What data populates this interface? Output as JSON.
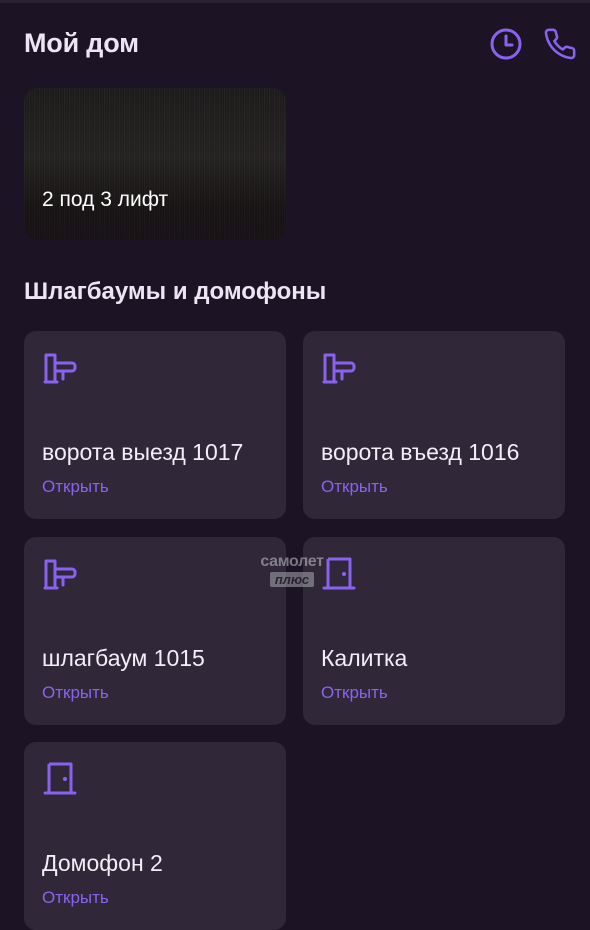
{
  "header": {
    "title": "Мой дом",
    "history_icon": "clock-icon",
    "call_icon": "phone-icon"
  },
  "camera": {
    "label": "2 под 3 лифт"
  },
  "section": {
    "title": "Шлагбаумы и домофоны"
  },
  "devices": [
    {
      "name": "ворота выезд 1017",
      "action": "Открыть",
      "icon": "barrier-icon"
    },
    {
      "name": "ворота въезд 1016",
      "action": "Открыть",
      "icon": "barrier-icon"
    },
    {
      "name": "шлагбаум 1015",
      "action": "Открыть",
      "icon": "barrier-icon"
    },
    {
      "name": "Калитка",
      "action": "Открыть",
      "icon": "door-icon"
    },
    {
      "name": "Домофон 2",
      "action": "Открыть",
      "icon": "door-icon"
    }
  ],
  "watermark": {
    "line1": "самолет",
    "line2": "плюс"
  },
  "colors": {
    "background": "#1c1424",
    "card": "#302839",
    "accent": "#8a62f0"
  }
}
